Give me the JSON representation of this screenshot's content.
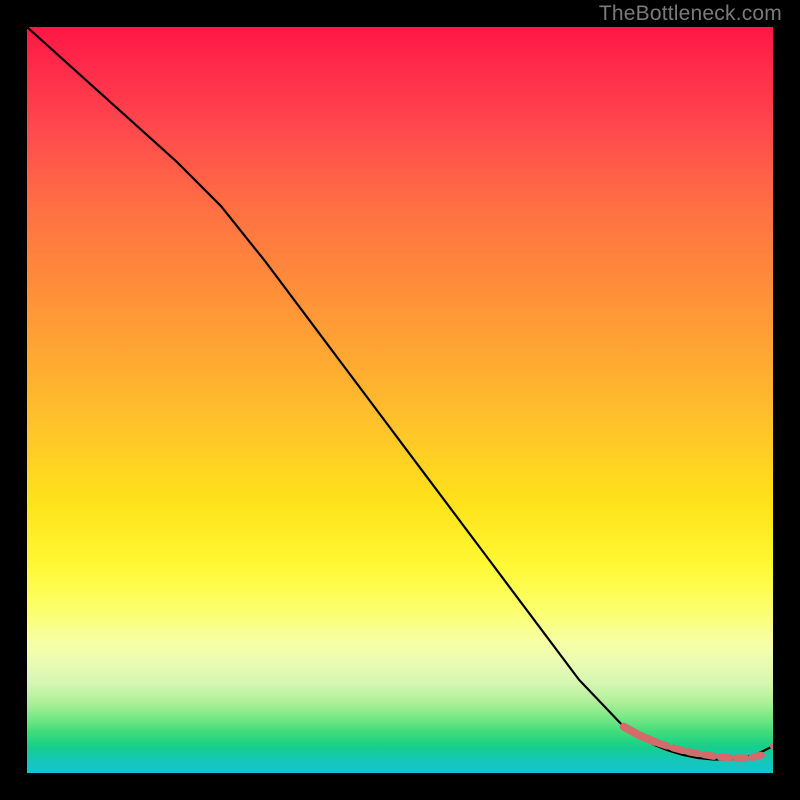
{
  "watermark": "TheBottleneck.com",
  "chart_data": {
    "type": "line",
    "title": "",
    "xlabel": "",
    "ylabel": "",
    "xlim": [
      0,
      100
    ],
    "ylim": [
      0,
      100
    ],
    "grid": false,
    "legend": false,
    "series": [
      {
        "name": "curve",
        "style": "solid-black",
        "x": [
          0,
          10,
          20,
          26,
          32,
          38,
          44,
          50,
          56,
          62,
          68,
          74,
          80,
          84,
          86,
          88,
          90,
          92,
          94,
          96,
          98,
          100
        ],
        "y": [
          100,
          91,
          82,
          76,
          68.5,
          60.5,
          52.5,
          44.5,
          36.5,
          28.5,
          20.5,
          12.5,
          6.2,
          3.8,
          3.0,
          2.4,
          2.0,
          1.8,
          1.8,
          2.0,
          2.6,
          3.6
        ]
      },
      {
        "name": "dashed-right",
        "style": "dashed-salmon",
        "x": [
          80.0,
          82.0,
          83.6,
          85.2,
          86.8,
          88.4,
          90.0,
          91.6,
          93.2,
          94.8,
          96.4,
          98.0,
          99.0,
          100.0
        ],
        "y": [
          6.2,
          5.1,
          4.4,
          3.8,
          3.3,
          2.9,
          2.6,
          2.3,
          2.1,
          2.0,
          2.0,
          2.2,
          2.6,
          3.6
        ]
      }
    ],
    "markers": [
      {
        "x": 100.0,
        "y": 3.6,
        "color": "#d46a6a",
        "r": 3.2
      }
    ]
  }
}
